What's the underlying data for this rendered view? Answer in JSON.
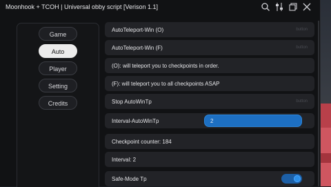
{
  "window": {
    "title": "Moonhook + TCOH | Universal obby script [Verison 1.1]",
    "icons": [
      "search-icon",
      "settings-sliders-icon",
      "restore-window-icon",
      "close-icon"
    ]
  },
  "sidebar": {
    "items": [
      {
        "label": "Game",
        "active": false
      },
      {
        "label": "Auto",
        "active": true
      },
      {
        "label": "Player",
        "active": false
      },
      {
        "label": "Setting",
        "active": false
      },
      {
        "label": "Credits",
        "active": false
      }
    ]
  },
  "content": {
    "rows": [
      {
        "type": "button",
        "label": "AutoTeleport-Win (O)",
        "hint": "button"
      },
      {
        "type": "button",
        "label": "AutoTeleport-Win (F)",
        "hint": "button"
      },
      {
        "type": "text",
        "label": "(O): will teleport you to checkpoints in order."
      },
      {
        "type": "text",
        "label": "(F): will teleport you to all checkpoints ASAP"
      },
      {
        "type": "button",
        "label": "Stop AutoWinTp",
        "hint": "button"
      },
      {
        "type": "input",
        "label": "Interval-AutoWinTp",
        "value": "2"
      },
      {
        "type": "text",
        "label": "Checkpoint counter: 184"
      },
      {
        "type": "text",
        "label": "Interval: 2"
      },
      {
        "type": "toggle",
        "label": "Safe-Mode Tp",
        "on": true
      }
    ]
  },
  "colors": {
    "accent": "#1d6fc2",
    "window_bg": "#111214",
    "row_bg": "#222327",
    "active_tab": "#ececec"
  }
}
